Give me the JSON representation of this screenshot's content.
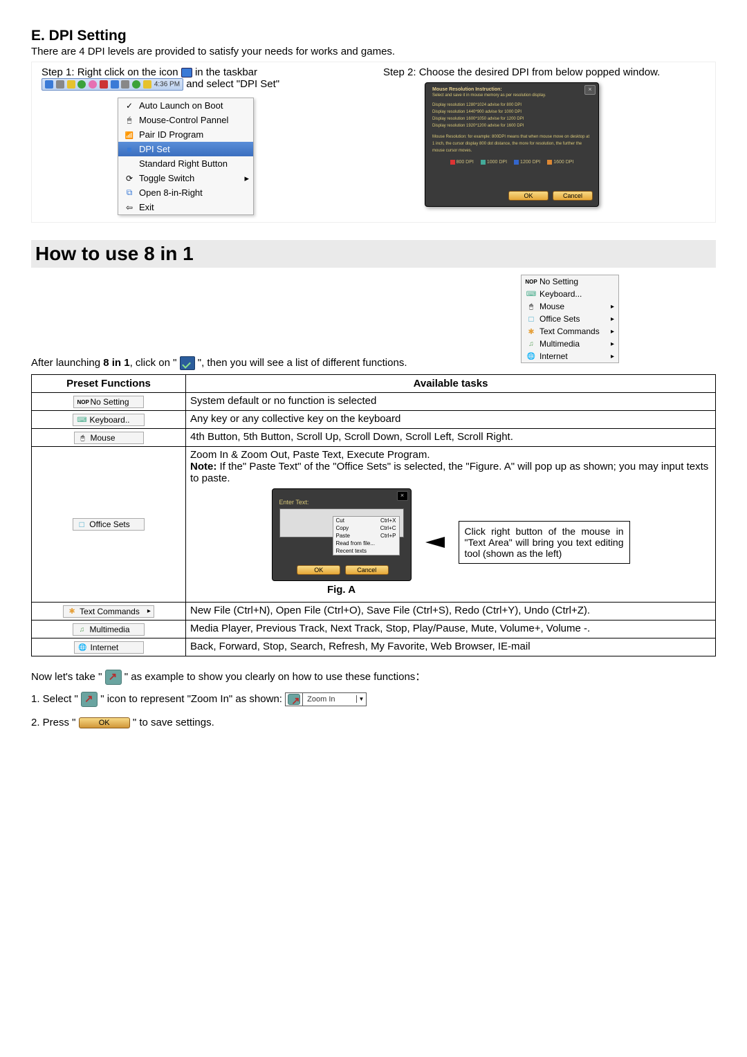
{
  "sectionE": {
    "title": "E. DPI Setting",
    "intro": "There are 4 DPI levels are provided to satisfy your needs for works and games.",
    "step1_a": "Step 1:  Right click on the icon ",
    "step1_b": " in the taskbar ",
    "step1_c": " and select \"DPI Set\"",
    "taskbar_time": "4:36 PM",
    "step2": "Step 2:  Choose the desired DPI from below popped window."
  },
  "contextMenu": {
    "items": [
      {
        "icon": "check",
        "label": "Auto Launch on Boot"
      },
      {
        "icon": "mouse",
        "label": "Mouse-Control Pannel"
      },
      {
        "icon": "pair",
        "label": "Pair ID Program"
      },
      {
        "icon": "dpi",
        "label": "DPI Set",
        "sel": true
      },
      {
        "icon": "",
        "label": "Standard Right Button"
      },
      {
        "icon": "toggle",
        "label": "Toggle Switch",
        "arrow": true
      },
      {
        "icon": "8",
        "label": "Open 8-in-Right"
      },
      {
        "icon": "exit",
        "label": "Exit"
      }
    ]
  },
  "dpiDialog": {
    "header": "Mouse Resolution Instruction:",
    "sub": "Select and save it in mouse memory as per resolution display.",
    "lines": [
      "Display resolution 1280*1024 advise for  800 DPI",
      "Display resolution 1440*900  advise for 1000 DPI",
      "Display resolution 1600*1050 advise for 1200 DPI",
      "Display resolution 1920*1200 advise for 1600 DPI"
    ],
    "note": "Mouse Resolution: for example: 800DPI means that when mouse move on desktop at 1 inch, the cursor display 800 dot distance, the more for resolution, the further the mouse cursor moves.",
    "chips": [
      "800 DPI",
      "1000 DPI",
      "1200 DPI",
      "1600 DPI"
    ],
    "ok": "OK",
    "cancel": "Cancel"
  },
  "section8": {
    "title": "How to use 8 in 1",
    "after_a": "After launching ",
    "after_bold": "8 in 1",
    "after_b": ", click on \" ",
    "after_c": " \", then you will see a list of different functions.",
    "th1": "Preset Functions",
    "th2": "Available tasks"
  },
  "popup8": [
    {
      "mi": "nop",
      "label": "No Setting"
    },
    {
      "mi": "kb",
      "label": "Keyboard..."
    },
    {
      "mi": "ms",
      "label": "Mouse",
      "arr": true
    },
    {
      "mi": "off",
      "label": "Office Sets",
      "arr": true
    },
    {
      "mi": "tc",
      "label": "Text Commands",
      "arr": true
    },
    {
      "mi": "mm",
      "label": "Multimedia",
      "arr": true
    },
    {
      "mi": "int",
      "label": "Internet",
      "arr": true
    }
  ],
  "funcTable": [
    {
      "mi": "nop",
      "name": "No Setting",
      "desc": "System default or no function is selected"
    },
    {
      "mi": "kb",
      "name": "Keyboard..",
      "desc": "Any key or any collective key on the keyboard"
    },
    {
      "mi": "ms",
      "name": "Mouse",
      "desc": "4th Button, 5th Button, Scroll Up, Scroll Down, Scroll Left, Scroll Right."
    }
  ],
  "officeRow": {
    "mi": "off",
    "name": "Office Sets",
    "line1": "Zoom In & Zoom Out, Paste Text, Execute Program.",
    "note_label": "Note:",
    "note": " If the\" Paste Text\" of the \"Office Sets\" is selected, the \"Figure. A\" will pop up as shown; you may input texts to paste.",
    "callout": "Click right button of the mouse in \"Text Area\" will bring you text editing tool (shown as the left)",
    "fig": "Fig. A"
  },
  "figA": {
    "enter": "Enter Text:",
    "ctx": [
      {
        "l": "Cut",
        "r": "Ctrl+X"
      },
      {
        "l": "Copy",
        "r": "Ctrl+C"
      },
      {
        "l": "Paste",
        "r": "Ctrl+P"
      },
      {
        "l": "Read from file...",
        "r": ""
      },
      {
        "l": "Recent texts",
        "r": ""
      }
    ],
    "ok": "OK",
    "cancel": "Cancel"
  },
  "restRows": [
    {
      "mi": "tc",
      "name": "Text Commands",
      "arr": true,
      "desc": "New File (Ctrl+N), Open File (Ctrl+O), Save File (Ctrl+S), Redo (Ctrl+Y), Undo (Ctrl+Z)."
    },
    {
      "mi": "mm",
      "name": "Multimedia",
      "desc": "Media Player, Previous Track, Next Track, Stop, Play/Pause, Mute, Volume+, Volume -."
    },
    {
      "mi": "int",
      "name": "Internet",
      "desc": "Back, Forward, Stop, Search, Refresh, My Favorite, Web Browser, IE-mail"
    }
  ],
  "bottom": {
    "now_a": "Now let's take  \" ",
    "now_b": " \"  as example to show you clearly on how to use these functions：",
    "sel_a": "1. Select  \" ",
    "sel_b": " \"  icon to represent \"Zoom In\" as shown: ",
    "zoom": "Zoom In",
    "press_a": "2. Press \" ",
    "ok": "OK",
    "press_b": " \" to save settings."
  }
}
